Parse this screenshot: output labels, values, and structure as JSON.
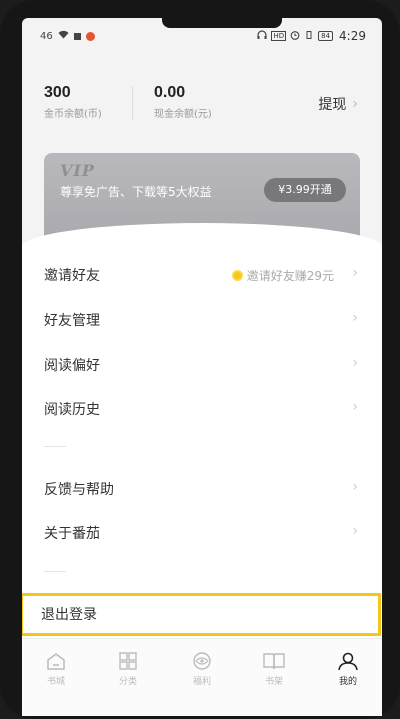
{
  "status_bar": {
    "signal": "46",
    "wifi": "wifi",
    "hd": "HD",
    "battery": "84",
    "time": "4:29"
  },
  "balance": {
    "coins": {
      "value": "300",
      "label": "金币余额(币)"
    },
    "cash": {
      "value": "0.00",
      "label": "现金余额(元)"
    },
    "withdraw_label": "提现"
  },
  "vip": {
    "title": "VIP",
    "desc": "尊享免广告、下载等5大权益",
    "button": "¥3.99开通"
  },
  "menu": {
    "invite": {
      "label": "邀请好友",
      "extra": "邀请好友赚29元"
    },
    "friends": {
      "label": "好友管理"
    },
    "preference": {
      "label": "阅读偏好"
    },
    "history": {
      "label": "阅读历史"
    },
    "feedback": {
      "label": "反馈与帮助"
    },
    "about": {
      "label": "关于番茄"
    },
    "logout": {
      "label": "退出登录"
    }
  },
  "tabs": [
    {
      "label": "书城",
      "icon": "home-icon"
    },
    {
      "label": "分类",
      "icon": "grid-icon"
    },
    {
      "label": "福利",
      "icon": "eye-icon"
    },
    {
      "label": "书架",
      "icon": "book-icon"
    },
    {
      "label": "我的",
      "icon": "profile-icon"
    }
  ],
  "colors": {
    "accent": "#f5c518",
    "vip_bg": "#b0b0b4"
  }
}
